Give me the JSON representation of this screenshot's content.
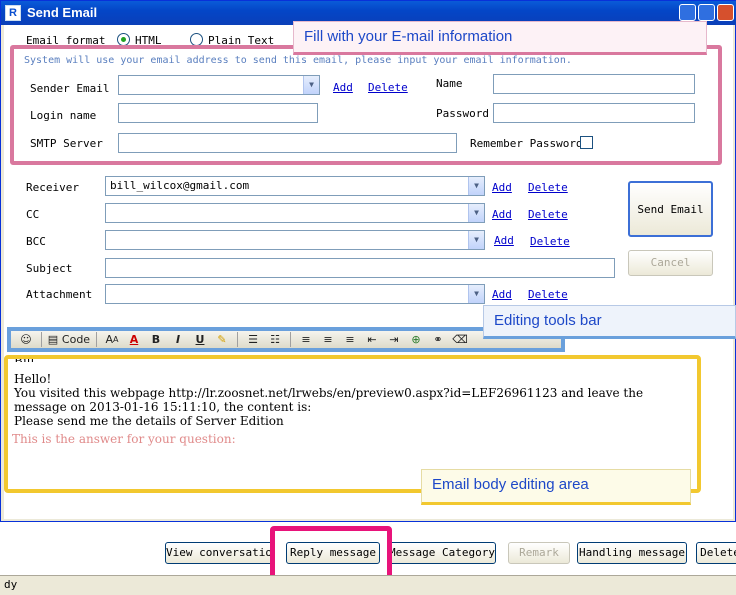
{
  "window": {
    "title": "Send Email",
    "app_icon": "R"
  },
  "format": {
    "label": "Email format",
    "html_label": "HTML",
    "plain_label": "Plain Text",
    "selected": "HTML"
  },
  "sender_section": {
    "note": "System will use your email address to send this email, please input your email information.",
    "sender_email_label": "Sender Email",
    "sender_email_value": "",
    "add_label": "Add",
    "delete_label": "Delete",
    "name_label": "Name",
    "name_value": "",
    "login_label": "Login name",
    "login_value": "",
    "password_label": "Password",
    "password_value": "",
    "smtp_label": "SMTP Server",
    "smtp_value": "",
    "remember_label": "Remember Password",
    "remember_checked": false
  },
  "recipients": {
    "receiver_label": "Receiver",
    "receiver_value": "bill_wilcox@gmail.com",
    "cc_label": "CC",
    "cc_value": "",
    "bcc_label": "BCC",
    "bcc_value": "",
    "subject_label": "Subject",
    "subject_value": "",
    "attachment_label": "Attachment",
    "attachment_value": "",
    "add_label": "Add",
    "delete_label": "Delete"
  },
  "actions": {
    "send_label": "Send Email",
    "cancel_label": "Cancel"
  },
  "toolbar": {
    "code_label": "Code"
  },
  "body": {
    "line0": "Bill",
    "line1": "Hello!",
    "line2": "You visited this webpage http://lr.zoosnet.net/lrwebs/en/preview0.aspx?id=LEF26961123 and leave the",
    "line3": "message on 2013-01-16 15:11:10, the content is:",
    "line4": "Please send me the details of Server Edition",
    "answer": "This is the answer for your question:"
  },
  "callouts": {
    "fill_info": "Fill with your E-mail information",
    "toolbar": "Editing tools bar",
    "body": "Email body editing area"
  },
  "bottom_buttons": {
    "view_conversation": "View conversation",
    "reply_message": "Reply message",
    "message_category": "Message Category",
    "remark": "Remark",
    "handling_message": "Handling message",
    "delete": "Delete"
  },
  "status": {
    "text": "dy"
  },
  "colors": {
    "accent_pink": "#e8137a",
    "callout_bg": "#fdf2f6",
    "highlight_yellow": "#f2c82f",
    "toolbar_highlight": "#6aa0dc"
  }
}
